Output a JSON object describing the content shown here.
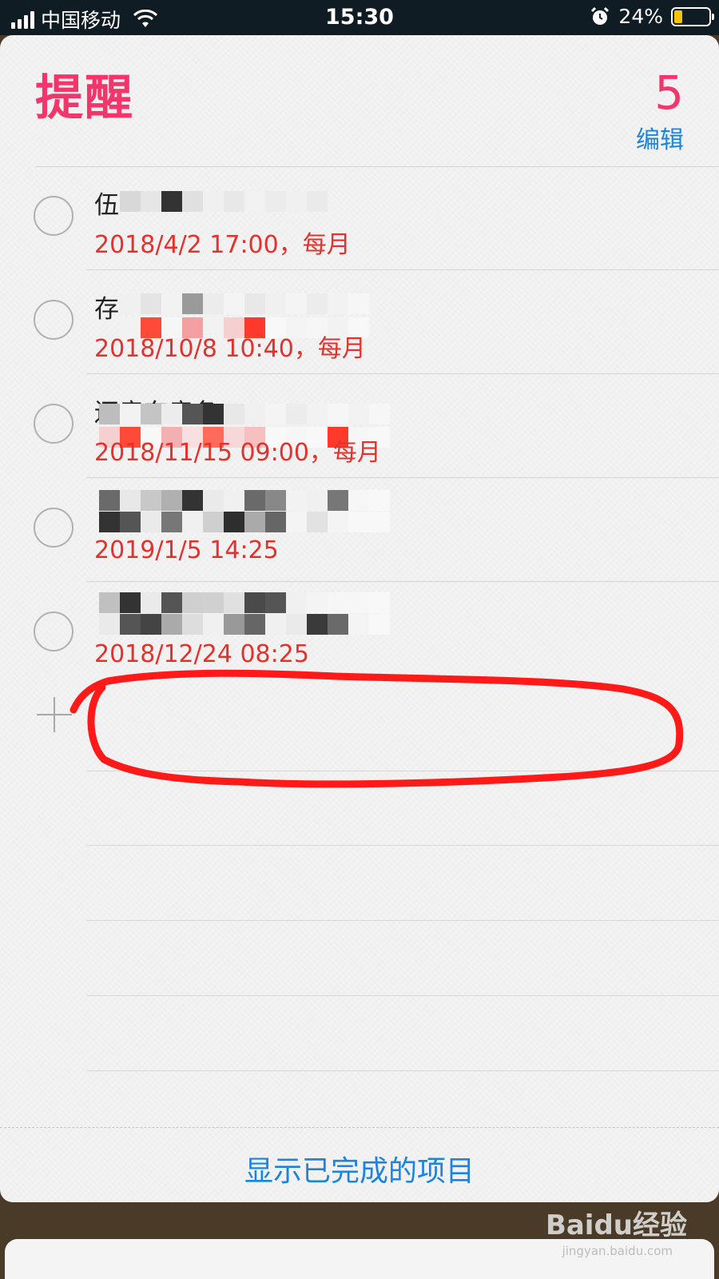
{
  "status_bar": {
    "carrier": "中国移动",
    "time": "15:30",
    "battery": "24%",
    "battery_level": 0.24
  },
  "header": {
    "title": "提醒",
    "count": "5",
    "edit_label": "编辑"
  },
  "reminders": [
    {
      "title": "伍",
      "due": "2018/4/2 17:00，每月"
    },
    {
      "title": "存",
      "due": "2018/10/8 10:40，每月"
    },
    {
      "title": "还房东房备",
      "due": "2018/11/15 09:00，每月"
    },
    {
      "title": "",
      "due": "2019/1/5 14:25"
    },
    {
      "title": "",
      "due": "2018/12/24 08:25"
    }
  ],
  "footer": {
    "show_completed": "显示已完成的项目"
  },
  "watermark": {
    "brand": "Baidu经验",
    "url": "jingyan.baidu.com"
  },
  "colors": {
    "accent_red": "#f2356a",
    "link_blue": "#1a84e0",
    "due_red": "#e5302b",
    "annotation_red": "#ff1a1a"
  }
}
